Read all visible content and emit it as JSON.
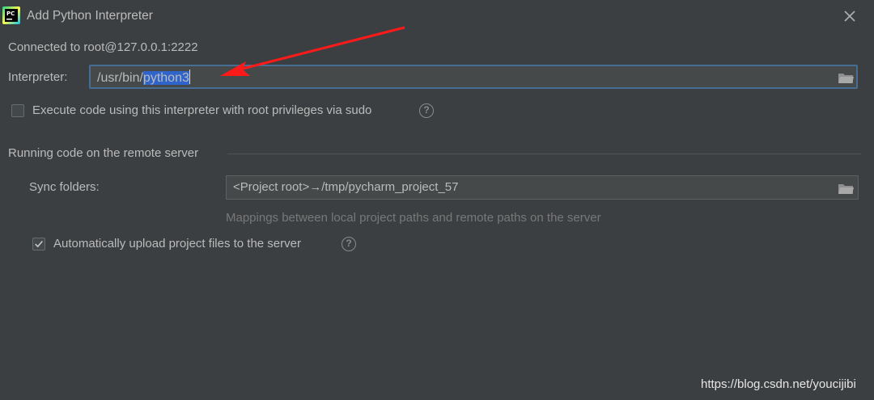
{
  "window": {
    "title": "Add Python Interpreter"
  },
  "connection": {
    "text": "Connected to root@127.0.0.1:2222"
  },
  "interpreter": {
    "label": "Interpreter:",
    "value_prefix": "/usr/bin/",
    "value_selected": "python3"
  },
  "sudo": {
    "label": "Execute code using this interpreter with root privileges via sudo",
    "checked": false
  },
  "remote": {
    "section_title": "Running code on the remote server",
    "sync_label": "Sync folders:",
    "sync_value": "<Project root>→/tmp/pycharm_project_57",
    "sync_hint": "Mappings between local project paths and remote paths on the server",
    "auto_upload_label": "Automatically upload project files to the server",
    "auto_upload_checked": true
  },
  "icons": {
    "app": "pycharm-icon",
    "close": "close-icon",
    "folder": "folder-icon",
    "help": "help-icon",
    "checkbox_check": "checkmark-icon"
  },
  "colors": {
    "background": "#3c3f41",
    "field_background": "#45494a",
    "focus_border": "#466d94",
    "selection": "#2f65ca",
    "arrow": "#ff1a1a"
  },
  "watermark": "https://blog.csdn.net/youcijibi"
}
